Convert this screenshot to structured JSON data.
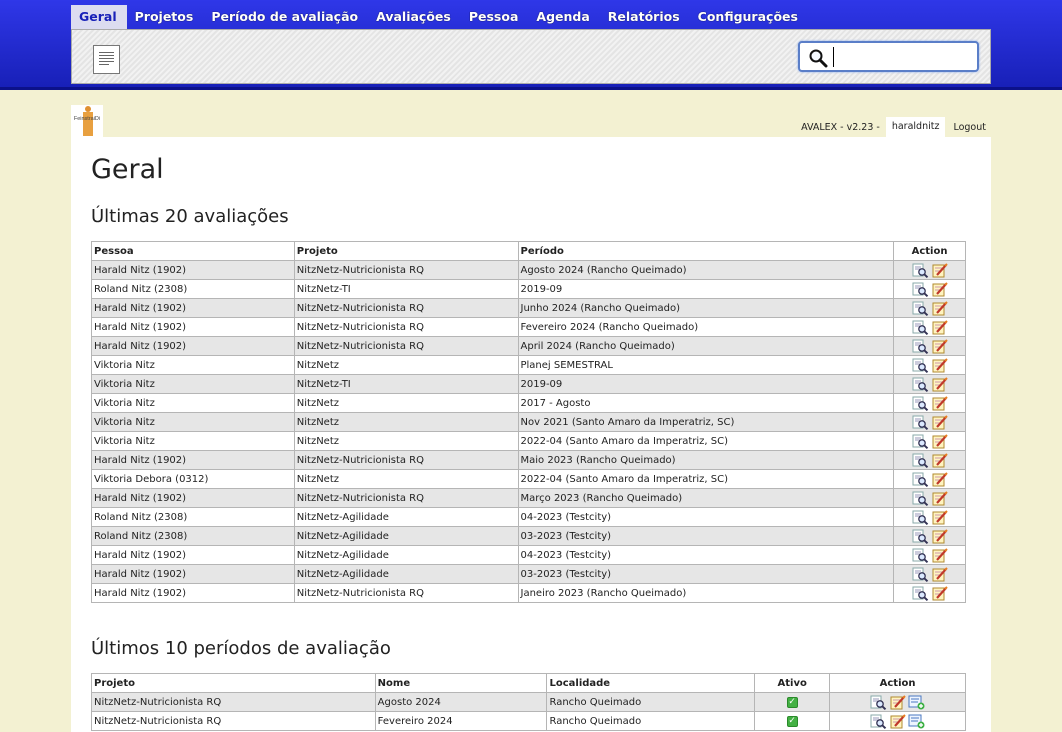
{
  "menu": [
    "Geral",
    "Projetos",
    "Período de avaliação",
    "Avaliações",
    "Pessoa",
    "Agenda",
    "Relatórios",
    "Configurações"
  ],
  "search": {
    "value": "",
    "placeholder": ""
  },
  "logo_text": "FeinstraiDi",
  "userbar": {
    "version": "AVALEX - v2.23 -",
    "user": "haraldnitz",
    "logout": "Logout"
  },
  "page_title": "Geral",
  "evaluations": {
    "title": "Últimas 20 avaliações",
    "headers": [
      "Pessoa",
      "Projeto",
      "Período",
      "Action"
    ],
    "rows": [
      [
        "Harald Nitz (1902)",
        "NitzNetz-Nutricionista RQ",
        "Agosto 2024 (Rancho Queimado)"
      ],
      [
        "Roland Nitz (2308)",
        "NitzNetz-TI",
        "2019-09"
      ],
      [
        "Harald Nitz (1902)",
        "NitzNetz-Nutricionista RQ",
        "Junho 2024 (Rancho Queimado)"
      ],
      [
        "Harald Nitz (1902)",
        "NitzNetz-Nutricionista RQ",
        "Fevereiro 2024 (Rancho Queimado)"
      ],
      [
        "Harald Nitz (1902)",
        "NitzNetz-Nutricionista RQ",
        "April 2024 (Rancho Queimado)"
      ],
      [
        "Viktoria Nitz",
        "NitzNetz",
        "Planej SEMESTRAL"
      ],
      [
        "Viktoria Nitz",
        "NitzNetz-TI",
        "2019-09"
      ],
      [
        "Viktoria Nitz",
        "NitzNetz",
        "2017 - Agosto"
      ],
      [
        "Viktoria Nitz",
        "NitzNetz",
        "Nov 2021 (Santo Amaro da Imperatriz, SC)"
      ],
      [
        "Viktoria Nitz",
        "NitzNetz",
        "2022-04 (Santo Amaro da Imperatriz, SC)"
      ],
      [
        "Harald Nitz (1902)",
        "NitzNetz-Nutricionista RQ",
        "Maio 2023 (Rancho Queimado)"
      ],
      [
        "Viktoria Debora (0312)",
        "NitzNetz",
        "2022-04 (Santo Amaro da Imperatriz, SC)"
      ],
      [
        "Harald Nitz (1902)",
        "NitzNetz-Nutricionista RQ",
        "Março 2023 (Rancho Queimado)"
      ],
      [
        "Roland Nitz (2308)",
        "NitzNetz-Agilidade",
        "04-2023 (Testcity)"
      ],
      [
        "Roland Nitz (2308)",
        "NitzNetz-Agilidade",
        "03-2023 (Testcity)"
      ],
      [
        "Harald Nitz (1902)",
        "NitzNetz-Agilidade",
        "04-2023 (Testcity)"
      ],
      [
        "Harald Nitz (1902)",
        "NitzNetz-Agilidade",
        "03-2023 (Testcity)"
      ],
      [
        "Harald Nitz (1902)",
        "NitzNetz-Nutricionista RQ",
        "Janeiro 2023 (Rancho Queimado)"
      ]
    ]
  },
  "periods": {
    "title": "Últimos 10 períodos de avaliação",
    "headers": [
      "Projeto",
      "Nome",
      "Localidade",
      "Ativo",
      "Action"
    ],
    "rows": [
      [
        "NitzNetz-Nutricionista RQ",
        "Agosto 2024",
        "Rancho Queimado",
        true
      ],
      [
        "NitzNetz-Nutricionista RQ",
        "Fevereiro 2024",
        "Rancho Queimado",
        true
      ]
    ]
  },
  "icons": {
    "view": "magnifier-view-icon",
    "edit": "edit-note-icon",
    "add": "add-list-icon",
    "active": "green-check-icon"
  }
}
